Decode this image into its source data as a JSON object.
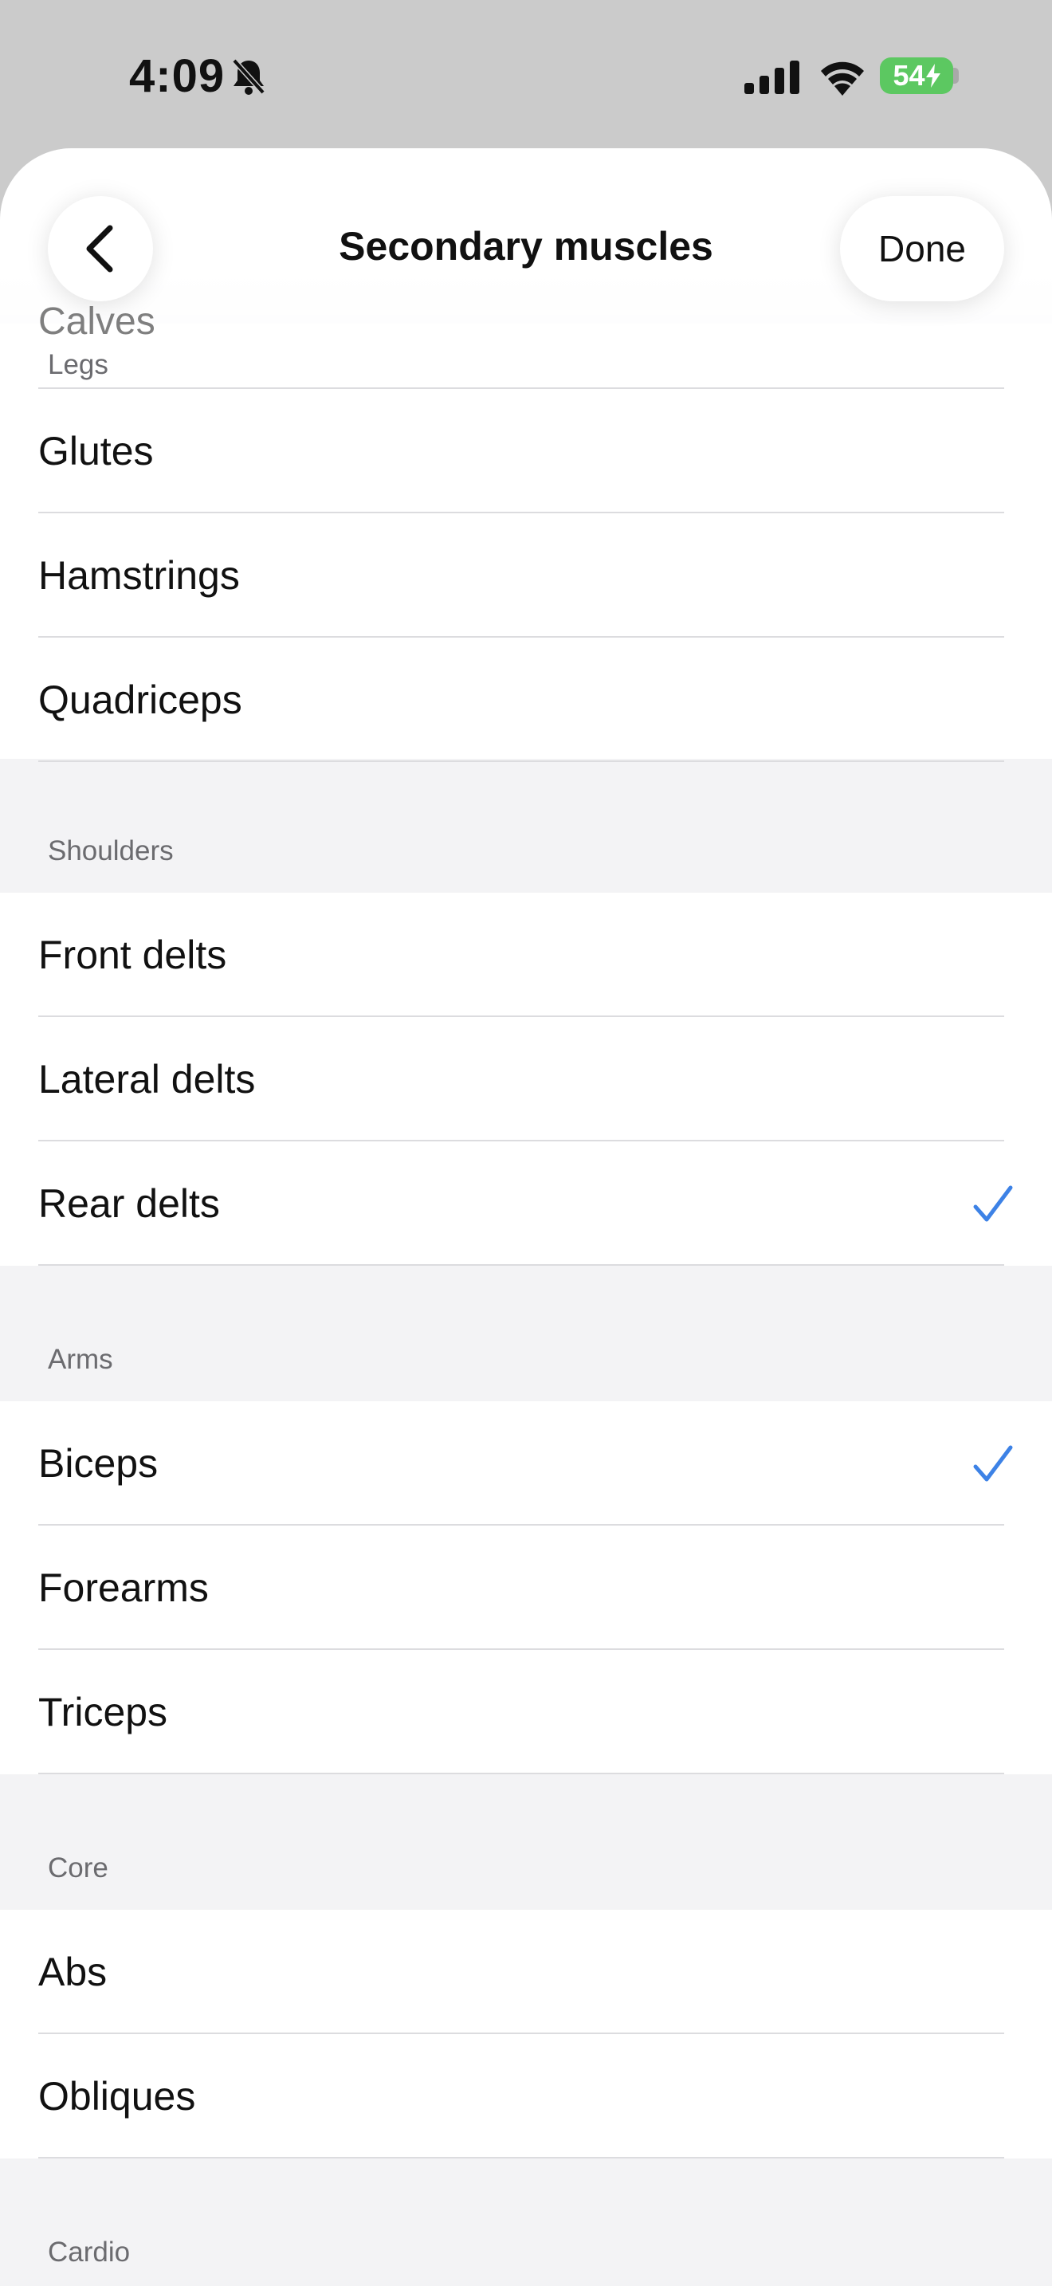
{
  "status_bar": {
    "time": "4:09",
    "battery": "54"
  },
  "nav": {
    "title": "Secondary muscles",
    "done_label": "Done"
  },
  "ghost_row": "Calves",
  "sections": {
    "legs": {
      "header": "Legs",
      "items": [
        "Glutes",
        "Hamstrings",
        "Quadriceps"
      ]
    },
    "shoulders": {
      "header": "Shoulders",
      "items": [
        "Front delts",
        "Lateral delts",
        "Rear delts"
      ]
    },
    "arms": {
      "header": "Arms",
      "items": [
        "Biceps",
        "Forearms",
        "Triceps"
      ]
    },
    "core": {
      "header": "Core",
      "items": [
        "Abs",
        "Obliques"
      ]
    },
    "cardio": {
      "header": "Cardio"
    }
  },
  "selected": [
    "Rear delts",
    "Biceps"
  ],
  "colors": {
    "accent": "#3d82e6",
    "battery": "#5cc861"
  }
}
